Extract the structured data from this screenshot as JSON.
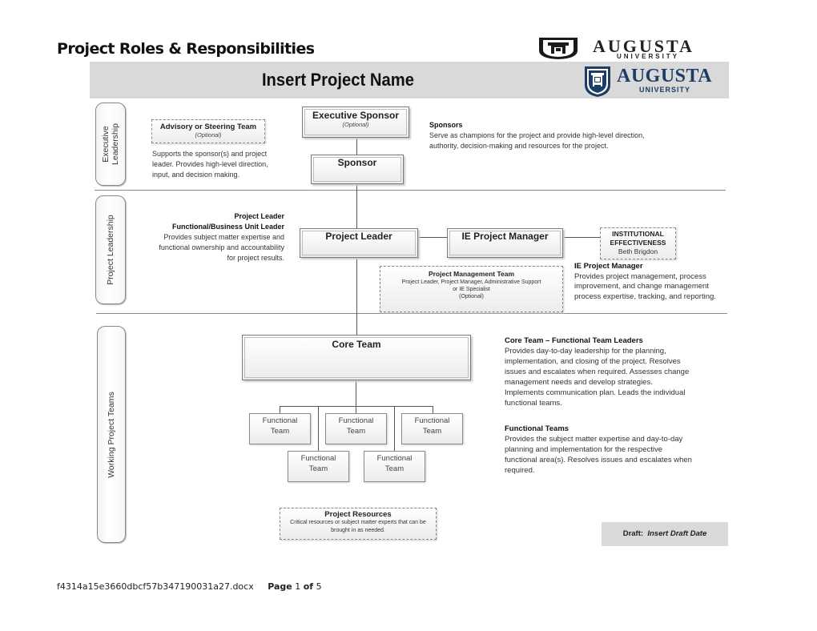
{
  "document": {
    "title": "Project Roles & Responsibilities",
    "footer": {
      "filename": "f4314a15e3660dbcf57b347190031a27.docx",
      "page_label": "Page",
      "page_current": "1",
      "of_label": "of",
      "page_total": "5"
    }
  },
  "logo": {
    "word": "AUGUSTA",
    "sub": "UNIVERSITY",
    "brand_color": "#1c3d66"
  },
  "banner": {
    "title": "Insert Project Name",
    "background": "#d9d9d9"
  },
  "lanes": [
    {
      "label_line1": "Executive",
      "label_line2": "Leadership"
    },
    {
      "label": "Project Leadership"
    },
    {
      "label": "Working Project Teams"
    }
  ],
  "executive": {
    "advisory": {
      "title": "Advisory or Steering Team",
      "optional": "(Optional)",
      "description": "Supports the sponsor(s) and project leader.  Provides high-level direction, input, and decision making."
    },
    "executive_sponsor": {
      "title": "Executive Sponsor",
      "optional": "(Optional)"
    },
    "sponsor": {
      "title": "Sponsor"
    },
    "sponsors_desc": {
      "heading": "Sponsors",
      "text": "Serve as champions for the project and provide high-level direction, authority, decision-making and resources for the project."
    }
  },
  "leadership": {
    "leader_desc": {
      "heading_line1": "Project Leader",
      "heading_line2": "Functional/Business Unit Leader",
      "text": "Provides subject matter expertise and functional ownership and accountability for project results."
    },
    "project_leader": {
      "title": "Project Leader"
    },
    "ie_pm": {
      "title": "IE Project Manager"
    },
    "ie_office": {
      "line1": "INSTITUTIONAL",
      "line2": "EFFECTIVENESS",
      "name": "Beth Brigdon"
    },
    "pm_team": {
      "title": "Project Management Team",
      "line1": "Project Leader, Project Manager, Administrative Support",
      "line2": "or IE Specialist",
      "optional": "(Optional)"
    },
    "ie_pm_desc": {
      "heading": "IE Project Manager",
      "text": "Provides project management, process improvement, and change management process expertise, tracking, and reporting."
    }
  },
  "working": {
    "core_team": {
      "title": "Core Team"
    },
    "functional_teams": [
      {
        "label": "Functional Team"
      },
      {
        "label": "Functional Team"
      },
      {
        "label": "Functional Team"
      },
      {
        "label": "Functional Team"
      },
      {
        "label": "Functional Team"
      }
    ],
    "core_desc": {
      "heading": "Core Team – Functional Team Leaders",
      "text": "Provides day-to-day leadership for the planning, implementation, and closing of the project.  Resolves issues and escalates when required.  Assesses change management needs and develop strategies.  Implements communication plan.  Leads the individual functional teams."
    },
    "functional_desc": {
      "heading": "Functional Teams",
      "text": "Provides the subject matter expertise and day-to-day planning and implementation for the respective functional area(s).  Resolves issues and escalates when required."
    },
    "resources": {
      "title": "Project Resources",
      "text": "Critical resources or subject matter experts that can be brought in as needed."
    }
  },
  "draft": {
    "label": "Draft:",
    "value": "Insert Draft Date"
  }
}
